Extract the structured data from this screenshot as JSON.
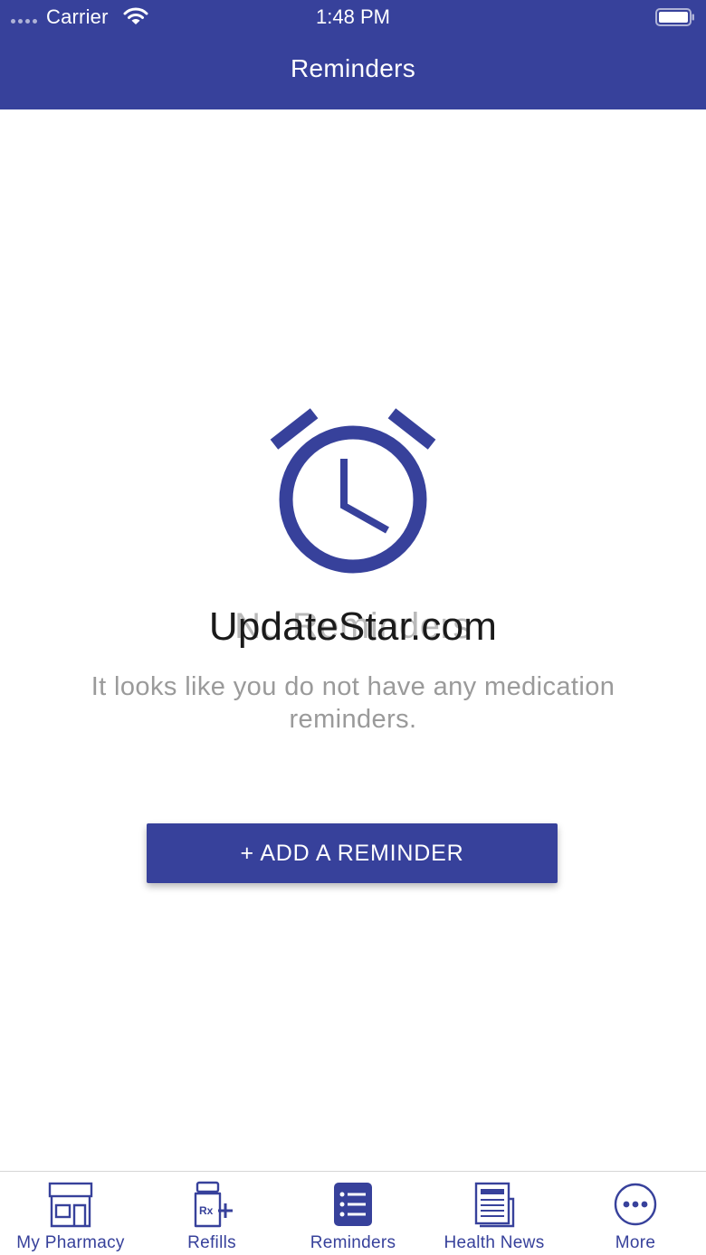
{
  "status_bar": {
    "carrier": "Carrier",
    "time": "1:48 PM"
  },
  "header": {
    "title": "Reminders"
  },
  "empty_state": {
    "icon": "alarm-clock-icon",
    "title": "No Reminders",
    "message": "It looks like you do not have any medication reminders.",
    "watermark": "UpdateStar.com"
  },
  "actions": {
    "add_reminder_label": "+ ADD A REMINDER"
  },
  "tabs": [
    {
      "label": "My Pharmacy",
      "icon": "storefront-icon",
      "selected": false
    },
    {
      "label": "Refills",
      "icon": "rx-bottle-icon",
      "selected": false
    },
    {
      "label": "Reminders",
      "icon": "list-icon",
      "selected": true
    },
    {
      "label": "Health News",
      "icon": "newspaper-icon",
      "selected": false
    },
    {
      "label": "More",
      "icon": "more-dots-icon",
      "selected": false
    }
  ],
  "colors": {
    "primary": "#37419b",
    "muted_text": "#9a9a9a",
    "background": "#ffffff"
  }
}
